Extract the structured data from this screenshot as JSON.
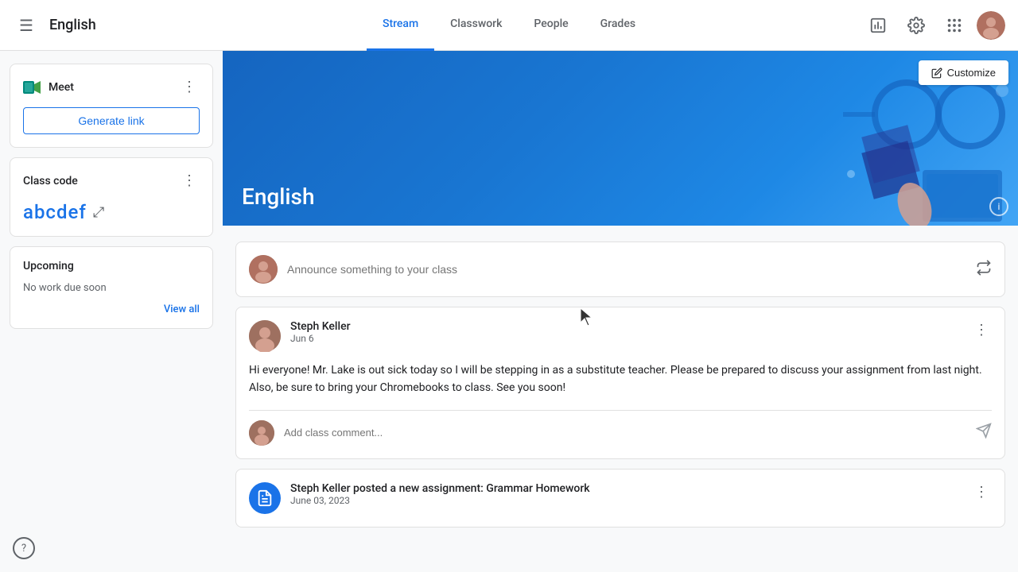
{
  "nav": {
    "hamburger_label": "☰",
    "class_title": "English",
    "tabs": [
      {
        "id": "stream",
        "label": "Stream",
        "active": true
      },
      {
        "id": "classwork",
        "label": "Classwork",
        "active": false
      },
      {
        "id": "people",
        "label": "People",
        "active": false
      },
      {
        "id": "grades",
        "label": "Grades",
        "active": false
      }
    ],
    "icons": {
      "chart": "⊞",
      "settings": "⚙",
      "apps": "⠿"
    }
  },
  "banner": {
    "class_name": "English",
    "customize_label": "Customize",
    "info_label": "i"
  },
  "sidebar": {
    "meet": {
      "title": "Meet",
      "generate_link_label": "Generate link"
    },
    "class_code": {
      "title": "Class code",
      "value": "abcdef"
    },
    "upcoming": {
      "title": "Upcoming",
      "empty_message": "No work due soon",
      "view_all_label": "View all"
    }
  },
  "stream": {
    "announce_placeholder": "Announce something to your class",
    "posts": [
      {
        "id": "post1",
        "author": "Steph Keller",
        "date": "Jun 6",
        "body": "Hi everyone! Mr. Lake is out sick today so I will be stepping in as a substitute teacher. Please be prepared to discuss your assignment from last night. Also, be sure to bring your Chromebooks to class. See you soon!",
        "comment_placeholder": "Add class comment..."
      }
    ],
    "assignments": [
      {
        "id": "assign1",
        "author_text": "Steph Keller posted a new assignment: Grammar Homework",
        "date": "June 03, 2023"
      }
    ]
  },
  "help": {
    "label": "?"
  }
}
